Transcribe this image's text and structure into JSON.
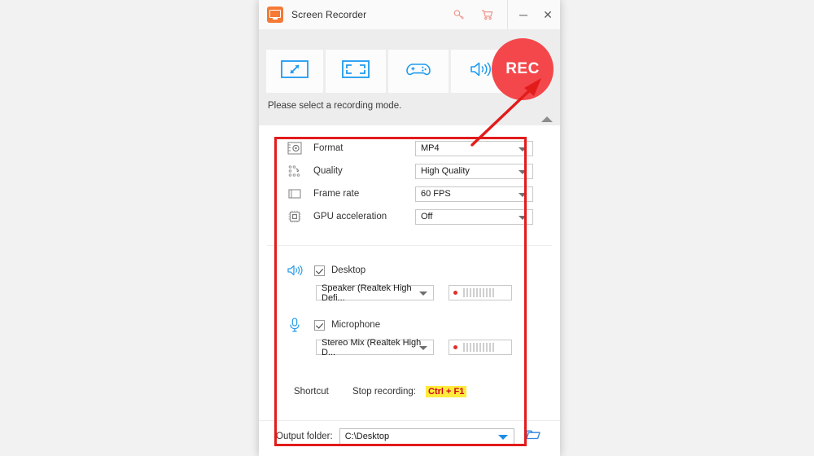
{
  "window": {
    "title": "Screen Recorder",
    "app_icon": "monitor-icon",
    "titlebar_icons": [
      "key-icon",
      "cart-icon"
    ],
    "minimize_label": "─",
    "close_label": "✕"
  },
  "modes": {
    "items": [
      {
        "name": "custom-region",
        "icon": "custom-region-icon"
      },
      {
        "name": "full-screen",
        "icon": "full-screen-icon"
      },
      {
        "name": "game-recording",
        "icon": "gamepad-icon"
      },
      {
        "name": "audio-recording",
        "icon": "speaker-icon"
      }
    ],
    "rec_label": "REC",
    "hint": "Please select a recording mode.",
    "collapse_icon": "chevron-up-icon"
  },
  "settings": {
    "rows": [
      {
        "icon": "format-film-icon",
        "label": "Format",
        "value": "MP4"
      },
      {
        "icon": "quality-dots-icon",
        "label": "Quality",
        "value": "High Quality"
      },
      {
        "icon": "frame-rate-icon",
        "label": "Frame rate",
        "value": "60 FPS"
      },
      {
        "icon": "gpu-chip-icon",
        "label": "GPU acceleration",
        "value": "Off"
      }
    ]
  },
  "audio": {
    "desktop": {
      "icon": "speaker-icon",
      "label": "Desktop",
      "checked": true,
      "device": "Speaker (Realtek High Defi..."
    },
    "microphone": {
      "icon": "microphone-icon",
      "label": "Microphone",
      "checked": true,
      "device": "Stereo Mix (Realtek High D..."
    }
  },
  "shortcut": {
    "label": "Shortcut",
    "action": "Stop recording:",
    "keys": "Ctrl + F1",
    "keys_highlight": "#ffeb3b",
    "keys_color": "#d0021b"
  },
  "output": {
    "label": "Output folder:",
    "path": "C:\\Desktop",
    "folder_icon": "folder-icon"
  },
  "annotation": {
    "box_color": "#e21b1b",
    "arrow_color": "#e21b1b"
  },
  "theme": {
    "accent_blue": "#1e9bf0",
    "rec_red": "#f4474b",
    "brand_orange": "#f47a36"
  }
}
